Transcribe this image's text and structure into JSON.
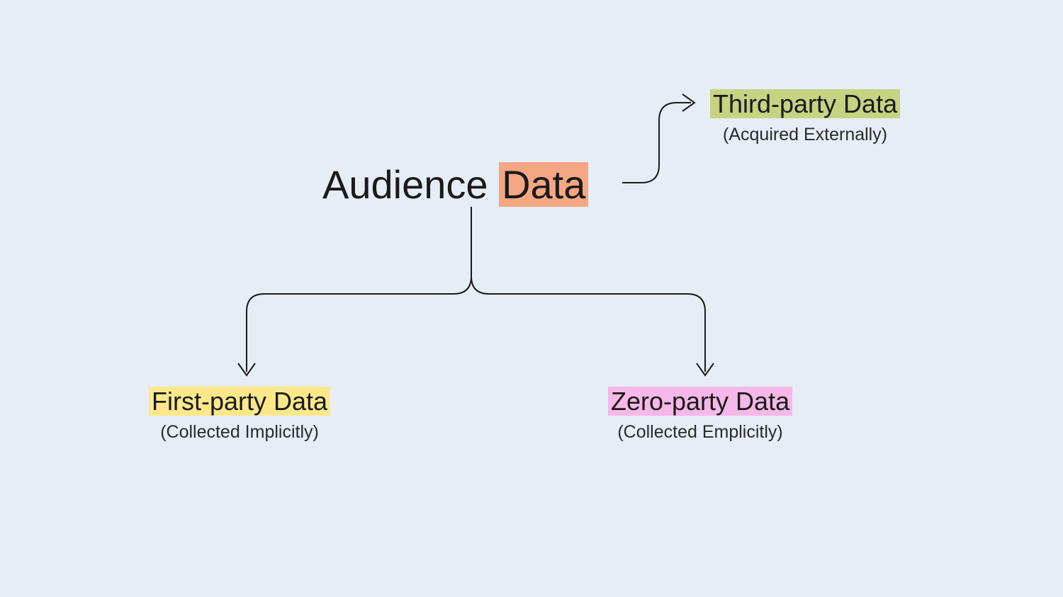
{
  "root": {
    "label_part1": "Audience ",
    "label_part2": "Data"
  },
  "nodes": {
    "third_party": {
      "title": "Third-party Data",
      "subtitle": "(Acquired Externally)"
    },
    "first_party": {
      "title": "First-party Data",
      "subtitle": "(Collected Implicitly)"
    },
    "zero_party": {
      "title": "Zero-party Data",
      "subtitle": "(Collected Emplicitly)"
    }
  },
  "colors": {
    "background": "#e6edf5",
    "text": "#1a1a1a",
    "highlight_orange": "#f5a783",
    "highlight_green": "#c5d382",
    "highlight_yellow": "#fce88a",
    "highlight_pink": "#f5b8e8"
  }
}
